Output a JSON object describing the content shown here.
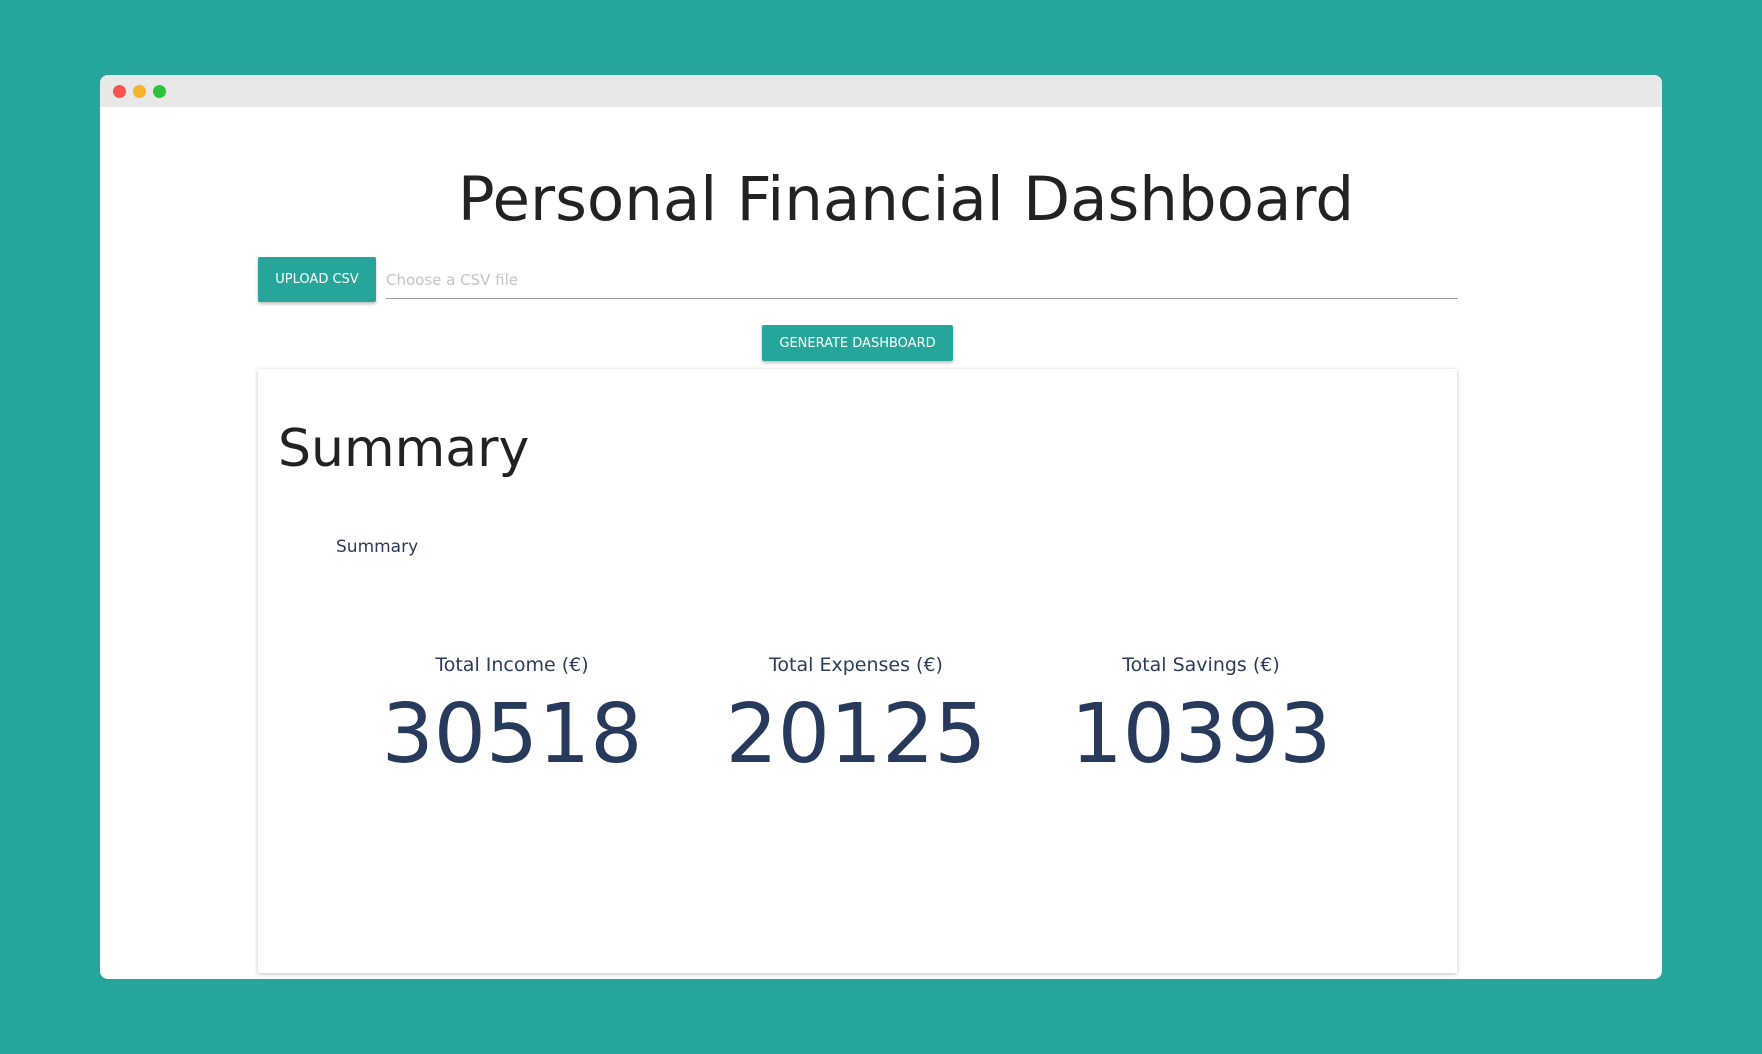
{
  "header": {
    "title": "Personal Financial Dashboard"
  },
  "upload": {
    "button_label": "UPLOAD CSV",
    "placeholder": "Choose a CSV file",
    "value": ""
  },
  "generate": {
    "button_label": "GENERATE DASHBOARD"
  },
  "summary": {
    "title": "Summary",
    "subtitle": "Summary",
    "metrics": [
      {
        "label": "Total Income (€)",
        "value": "30518"
      },
      {
        "label": "Total Expenses (€)",
        "value": "20125"
      },
      {
        "label": "Total Savings (€)",
        "value": "10393"
      }
    ]
  },
  "colors": {
    "background": "#26a69a",
    "accent": "#26a69a",
    "metric_text": "#273a5c",
    "window_close": "#f5554e",
    "window_minimize": "#f5b32b",
    "window_maximize": "#2ec23f"
  }
}
